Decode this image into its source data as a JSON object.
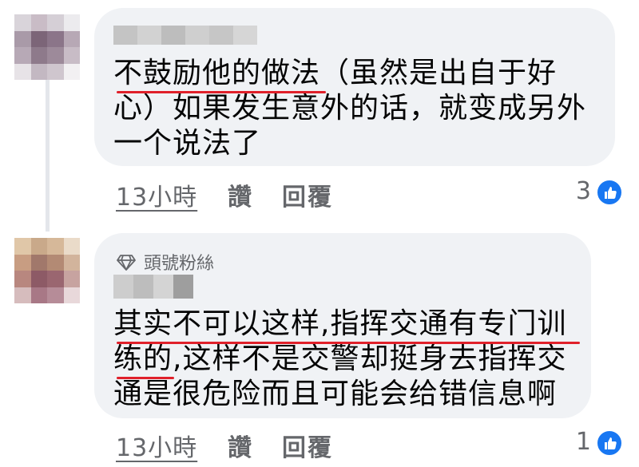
{
  "comments": [
    {
      "badge": "",
      "text_lines": [
        "不鼓励他的做法（虽然是出自于好",
        "心）如果发生意外的话，就变成另外",
        "一个说法了"
      ],
      "time": "13小時",
      "like_label": "讚",
      "reply_label": "回覆",
      "reaction_count": "3"
    },
    {
      "badge": "頭號粉絲",
      "text_lines": [
        "其实不可以这样,指挥交通有专门训",
        "练的,这样不是交警却挺身去指挥交",
        "通是很危险而且可能会给错信息啊"
      ],
      "time": "13小時",
      "like_label": "讚",
      "reply_label": "回覆",
      "reaction_count": "1"
    }
  ],
  "colors": {
    "bubble": "#f0f2f5",
    "annotation_underline": "#e0202a",
    "meta_text": "#65676b",
    "like_blue": "#1877f2"
  },
  "icons": [
    "diamond-icon",
    "thumbs-up-icon"
  ]
}
